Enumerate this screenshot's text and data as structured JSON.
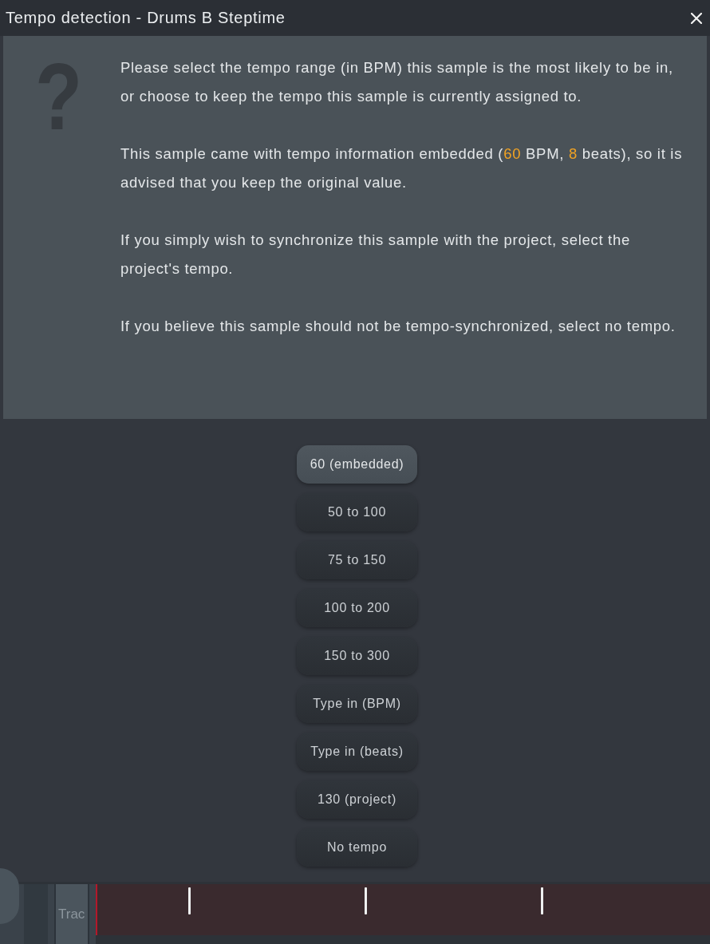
{
  "window": {
    "title": "Tempo detection - Drums B Steptime"
  },
  "message": {
    "icon": "?",
    "paragraphs": [
      [
        {
          "text": "Please select the tempo range (in BPM) this sample is the most likely to be in, or choose to keep the tempo this sample is currently assigned to.",
          "highlight": false
        }
      ],
      [
        {
          "text": "This sample came with tempo information embedded (",
          "highlight": false
        },
        {
          "text": "60",
          "highlight": true
        },
        {
          "text": " BPM, ",
          "highlight": false
        },
        {
          "text": "8",
          "highlight": true
        },
        {
          "text": " beats), so it is advised that you keep the original value.",
          "highlight": false
        }
      ],
      [
        {
          "text": "If you simply wish to synchronize this sample with the project, select the project's tempo.",
          "highlight": false
        }
      ],
      [
        {
          "text": "If you believe this sample should not be tempo-synchronized, select no tempo.",
          "highlight": false
        }
      ]
    ]
  },
  "options": [
    {
      "label": "60 (embedded)",
      "selected": true
    },
    {
      "label": "50 to 100",
      "selected": false
    },
    {
      "label": "75 to 150",
      "selected": false
    },
    {
      "label": "100 to 200",
      "selected": false
    },
    {
      "label": "150 to 300",
      "selected": false
    },
    {
      "label": "Type in (BPM)",
      "selected": false
    },
    {
      "label": "Type in (beats)",
      "selected": false
    },
    {
      "label": "130 (project)",
      "selected": false
    },
    {
      "label": "No tempo",
      "selected": false
    }
  ],
  "track": {
    "label": "Trac"
  }
}
